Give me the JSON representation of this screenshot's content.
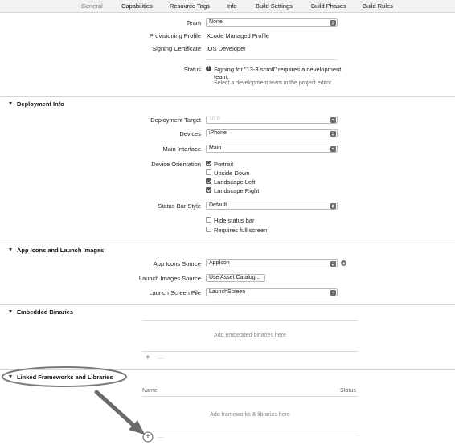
{
  "tabs": [
    {
      "label": "General"
    },
    {
      "label": "Capabilities"
    },
    {
      "label": "Resource Tags"
    },
    {
      "label": "Info"
    },
    {
      "label": "Build Settings"
    },
    {
      "label": "Build Phases"
    },
    {
      "label": "Build Rules"
    }
  ],
  "signing": {
    "team_label": "Team",
    "team_value": "None",
    "profile_label": "Provisioning Profile",
    "profile_value": "Xcode Managed Profile",
    "cert_label": "Signing Certificate",
    "cert_value": "iOS Developer",
    "status_label": "Status",
    "status_line1": "Signing for \"13-3 scroll\" requires a development",
    "status_line2": "team.",
    "status_line3": "Select a development team in the project editor."
  },
  "deployment": {
    "title": "Deployment Info",
    "target_label": "Deployment Target",
    "target_value": "10.0",
    "devices_label": "Devices",
    "devices_value": "iPhone",
    "interface_label": "Main Interface",
    "interface_value": "Main",
    "orientation_label": "Device Orientation",
    "orientations": [
      {
        "label": "Portrait",
        "checked": true
      },
      {
        "label": "Upside Down",
        "checked": false
      },
      {
        "label": "Landscape Left",
        "checked": true
      },
      {
        "label": "Landscape Right",
        "checked": true
      }
    ],
    "statusbar_label": "Status Bar Style",
    "statusbar_value": "Default",
    "hide_status_bar": "Hide status bar",
    "requires_full_screen": "Requires full screen"
  },
  "app_icons": {
    "title": "App Icons and Launch Images",
    "icons_label": "App Icons Source",
    "icons_value": "AppIcon",
    "launch_images_label": "Launch Images Source",
    "launch_images_button": "Use Asset Catalog...",
    "launch_screen_label": "Launch Screen File",
    "launch_screen_value": "LaunchScreen"
  },
  "embedded": {
    "title": "Embedded Binaries",
    "placeholder": "Add embedded binaries here",
    "add": "+",
    "remove": "—"
  },
  "linked": {
    "title": "Linked Frameworks and Libraries",
    "col_name": "Name",
    "col_status": "Status",
    "placeholder": "Add frameworks & libraries here",
    "add": "+",
    "remove": "—"
  },
  "colors": {
    "annotation": "#7a7a7a"
  }
}
